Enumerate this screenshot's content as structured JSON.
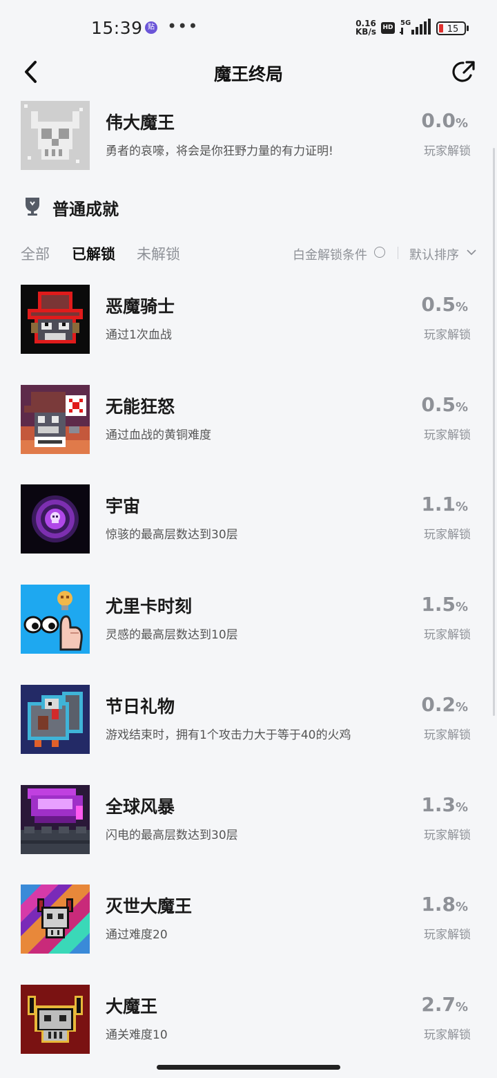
{
  "status_bar": {
    "time": "15:39",
    "app_badge": "贴",
    "more": "•••",
    "net_speed_value": "0.16",
    "net_speed_unit": "KB/s",
    "hd": "HD",
    "network": "5G",
    "battery": "15"
  },
  "header": {
    "title": "魔王终局",
    "back_icon": "chevron-left-icon",
    "share_icon": "share-icon"
  },
  "top_achievement": {
    "name": "伟大魔王",
    "description": "勇者的哀嚎，将会是你狂野力量的有力证明!",
    "percent": "0.0",
    "unlock_label": "玩家解锁",
    "icon": "grey-skull-icon"
  },
  "section": {
    "title": "普通成就",
    "icon": "trophy-icon"
  },
  "filters": {
    "tabs": [
      {
        "label": "全部",
        "active": false
      },
      {
        "label": "已解锁",
        "active": true
      },
      {
        "label": "未解锁",
        "active": false
      }
    ],
    "platinum_label": "白金解锁条件",
    "sort_label": "默认排序"
  },
  "achievements": [
    {
      "name": "恶魔骑士",
      "description": "通过1次血战",
      "percent": "0.5",
      "unlock_label": "玩家解锁",
      "icon": "demon-knight-icon"
    },
    {
      "name": "无能狂怒",
      "description": "通过血战的黄铜难度",
      "percent": "0.5",
      "unlock_label": "玩家解锁",
      "icon": "rage-icon"
    },
    {
      "name": "宇宙",
      "description": "惊骇的最高层数达到30层",
      "percent": "1.1",
      "unlock_label": "玩家解锁",
      "icon": "cosmos-icon"
    },
    {
      "name": "尤里卡时刻",
      "description": "灵感的最高层数达到10层",
      "percent": "1.5",
      "unlock_label": "玩家解锁",
      "icon": "eureka-icon"
    },
    {
      "name": "节日礼物",
      "description": "游戏结束时，拥有1个攻击力大于等于40的火鸡",
      "percent": "0.2",
      "unlock_label": "玩家解锁",
      "icon": "turkey-icon"
    },
    {
      "name": "全球风暴",
      "description": "闪电的最高层数达到30层",
      "percent": "1.3",
      "unlock_label": "玩家解锁",
      "icon": "storm-icon"
    },
    {
      "name": "灭世大魔王",
      "description": "通过难度20",
      "percent": "1.8",
      "unlock_label": "玩家解锁",
      "icon": "rainbow-skull-icon"
    },
    {
      "name": "大魔王",
      "description": "通关难度10",
      "percent": "2.7",
      "unlock_label": "玩家解锁",
      "icon": "red-skull-icon"
    }
  ],
  "percent_sign": "%"
}
